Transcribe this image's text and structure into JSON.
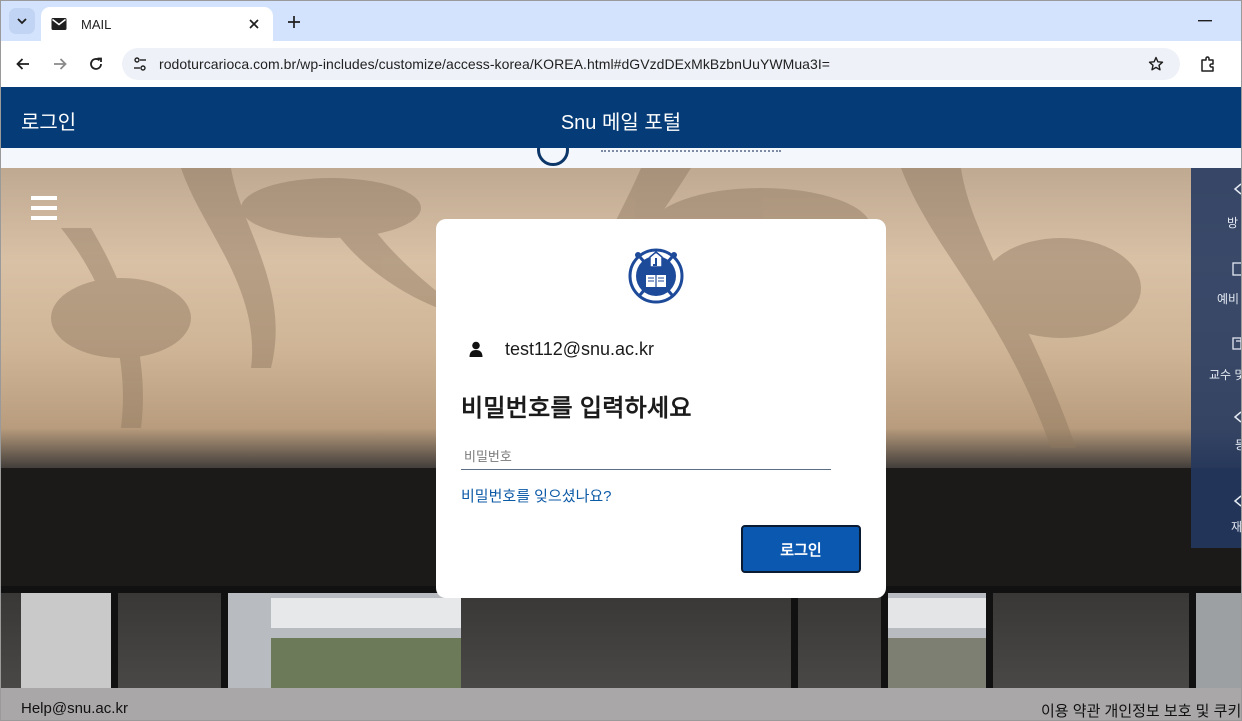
{
  "browser": {
    "tab": {
      "title": "MAIL"
    },
    "url": "rodoturcarioca.com.br/wp-includes/customize/access-korea/KOREA.html#dGVzdDExMkBzbnUuYWMua3I="
  },
  "header": {
    "login_label": "로그인",
    "title": "Snu 메일 포털",
    "color": "#053b76"
  },
  "side_menu": {
    "items": [
      {
        "label": "방",
        "icon": "chevron-left-icon"
      },
      {
        "label": "예비",
        "icon": "document-icon"
      },
      {
        "label": "교수 및",
        "icon": "book-icon"
      },
      {
        "label": "등",
        "icon": "chevron-left-icon"
      },
      {
        "label": "재",
        "icon": "chevron-left-icon"
      }
    ]
  },
  "login_card": {
    "emblem": "university-emblem",
    "user_email": "test112@snu.ac.kr",
    "heading": "비밀번호를 입력하세요",
    "password_placeholder": "비밀번호",
    "password_value": "",
    "forgot_password_link": "비밀번호를 잊으셨나요?",
    "login_button": "로그인",
    "button_color": "#0a58b0"
  },
  "footer": {
    "help_email": "Help@snu.ac.kr",
    "links": "이용 약관 개인정보 보호 및 쿠키"
  }
}
